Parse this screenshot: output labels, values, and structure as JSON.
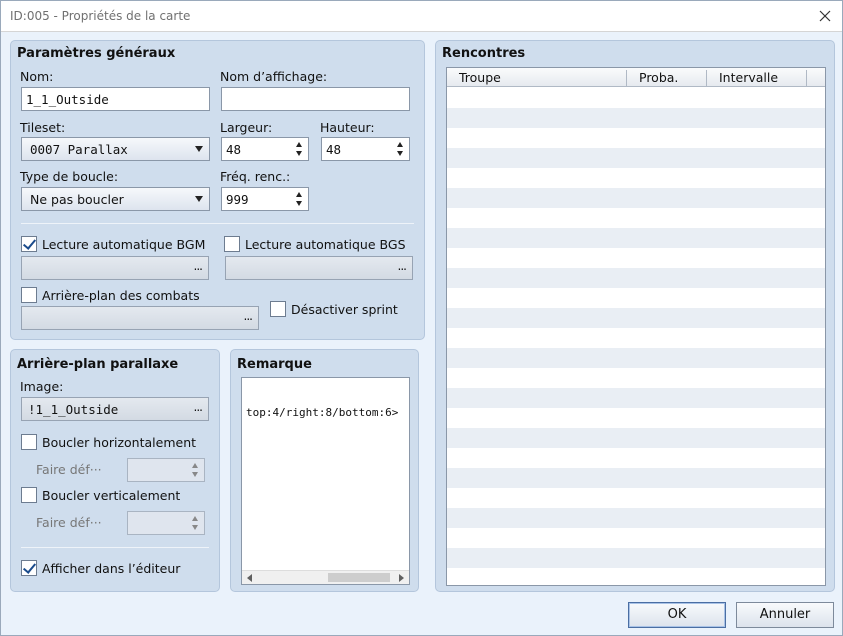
{
  "window": {
    "title": "ID:005 - Propriétés de la carte"
  },
  "general": {
    "title": "Paramètres généraux",
    "name_label": "Nom:",
    "name_value": "1_1_Outside",
    "display_name_label": "Nom d’affichage:",
    "display_name_value": "",
    "tileset_label": "Tileset:",
    "tileset_value": "0007 Parallax",
    "width_label": "Largeur:",
    "width_value": "48",
    "height_label": "Hauteur:",
    "height_value": "48",
    "loop_label": "Type de boucle:",
    "loop_value": "Ne pas boucler",
    "enc_label": "Fréq. renc.:",
    "enc_value": "999",
    "bgm_label": "Lecture automatique BGM",
    "bgm_checked": true,
    "bgs_label": "Lecture automatique BGS",
    "bgs_checked": false,
    "battleback_label": "Arrière-plan des combats",
    "battleback_checked": false,
    "sprint_label": "Désactiver sprint",
    "sprint_checked": false,
    "picker_dots": "..."
  },
  "parallax": {
    "title": "Arrière-plan parallaxe",
    "image_label": "Image:",
    "image_value": "!1_1_Outside",
    "loop_h_label": "Boucler horizontalement",
    "loop_h_checked": false,
    "scroll_h_label": "Faire déf···",
    "loop_v_label": "Boucler verticalement",
    "loop_v_checked": false,
    "scroll_v_label": "Faire déf···",
    "show_editor_label": "Afficher dans l’éditeur",
    "show_editor_checked": true
  },
  "note": {
    "title": "Remarque",
    "text": "top:4/right:8/bottom:6>"
  },
  "encounters": {
    "title": "Rencontres",
    "columns": [
      "Troupe",
      "Proba.",
      "Intervalle"
    ]
  },
  "buttons": {
    "ok": "OK",
    "cancel": "Annuler"
  }
}
